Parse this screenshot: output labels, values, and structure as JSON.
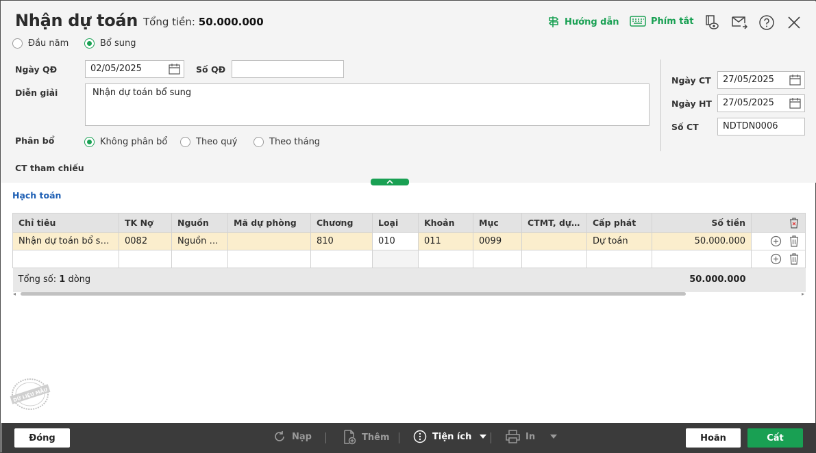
{
  "header": {
    "title": "Nhận dự toán",
    "total_label": "Tổng tiền:",
    "total_value": "50.000.000",
    "guide_label": "Hướng dẫn",
    "shortcut_label": "Phím tắt"
  },
  "type_options": [
    {
      "label": "Đầu năm",
      "checked": false
    },
    {
      "label": "Bổ sung",
      "checked": true
    }
  ],
  "form": {
    "ngay_qd_label": "Ngày QĐ",
    "ngay_qd_value": "02/05/2025",
    "so_qd_label": "Số QĐ",
    "so_qd_value": "",
    "dien_giai_label": "Diễn giải",
    "dien_giai_value": "Nhận dự toán bổ sung",
    "phan_bo_label": "Phân bổ",
    "phan_bo_options": [
      {
        "label": "Không phân bổ",
        "checked": true
      },
      {
        "label": "Theo quý",
        "checked": false
      },
      {
        "label": "Theo tháng",
        "checked": false
      }
    ],
    "ct_tham_chieu_label": "CT tham chiếu",
    "ngay_ct_label": "Ngày CT",
    "ngay_ct_value": "27/05/2025",
    "ngay_ht_label": "Ngày HT",
    "ngay_ht_value": "27/05/2025",
    "so_ct_label": "Số CT",
    "so_ct_value": "NDTDN0006"
  },
  "tab_label": "Hạch toán",
  "table": {
    "columns": [
      "Chỉ tiêu",
      "TK Nợ",
      "Nguồn",
      "Mã dự phòng",
      "Chương",
      "Loại",
      "Khoản",
      "Mục",
      "CTMT, dự án",
      "Cấp phát",
      "Số tiền"
    ],
    "rows": [
      [
        "Nhận dự toán bổ sung",
        "0082",
        "Nguồn n...",
        "",
        "810",
        "010",
        "011",
        "0099",
        "",
        "Dự toán",
        "50.000.000"
      ]
    ],
    "summary_prefix": "Tổng số: ",
    "summary_count": "1",
    "summary_suffix": " dòng",
    "summary_total": "50.000.000"
  },
  "stamp_text": "DỮ LIỆU MẪU",
  "footer": {
    "close_label": "Đóng",
    "load_label": "Nạp",
    "add_label": "Thêm",
    "utility_label": "Tiện ích",
    "print_label": "In",
    "cancel_label": "Hoãn",
    "save_label": "Cất"
  },
  "colors": {
    "accent": "#19a053",
    "link": "#1e5fb4",
    "row_highlight": "#fbeecd",
    "footer_bg": "#3b3b3b"
  }
}
